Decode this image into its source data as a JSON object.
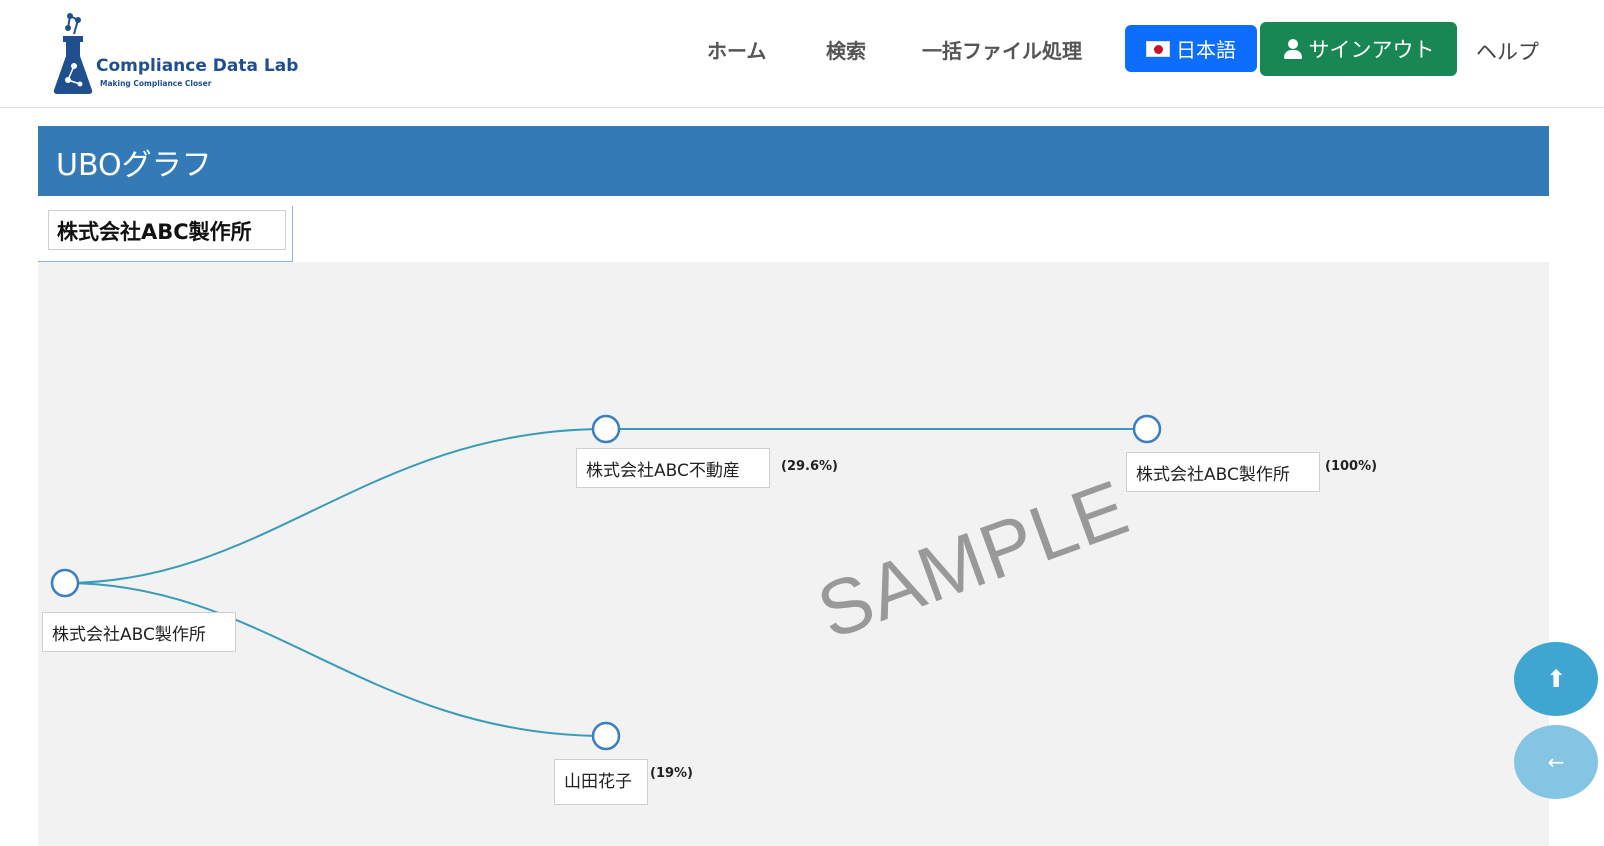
{
  "brand": {
    "name": "Compliance Data Lab",
    "tagline": "Making Compliance Closer",
    "color": "#1f4f8f"
  },
  "nav": {
    "home": "ホーム",
    "search": "検索",
    "batch": "一括ファイル処理",
    "language": "日本語",
    "signout": "サインアウト",
    "help": "ヘルプ"
  },
  "page": {
    "title": "UBOグラフ",
    "tab": "株式会社ABC製作所"
  },
  "graph": {
    "root": {
      "label": "株式会社ABC製作所"
    },
    "nodes": [
      {
        "label": "株式会社ABC不動産",
        "percent": "(29.6%)"
      },
      {
        "label": "株式会社ABC製作所",
        "percent": "(100%)"
      },
      {
        "label": "山田花子",
        "percent": "(19%)"
      }
    ],
    "watermark": "SAMPLE",
    "link_color": "#3a9ab8",
    "node_color": "#3a7fc1"
  },
  "fab": {
    "up_icon": "arrow-up-icon",
    "back_icon": "arrow-left-icon"
  },
  "colors": {
    "header_band": "#337ab7",
    "language_button": "#0d6efd",
    "signout_button": "#198754"
  }
}
